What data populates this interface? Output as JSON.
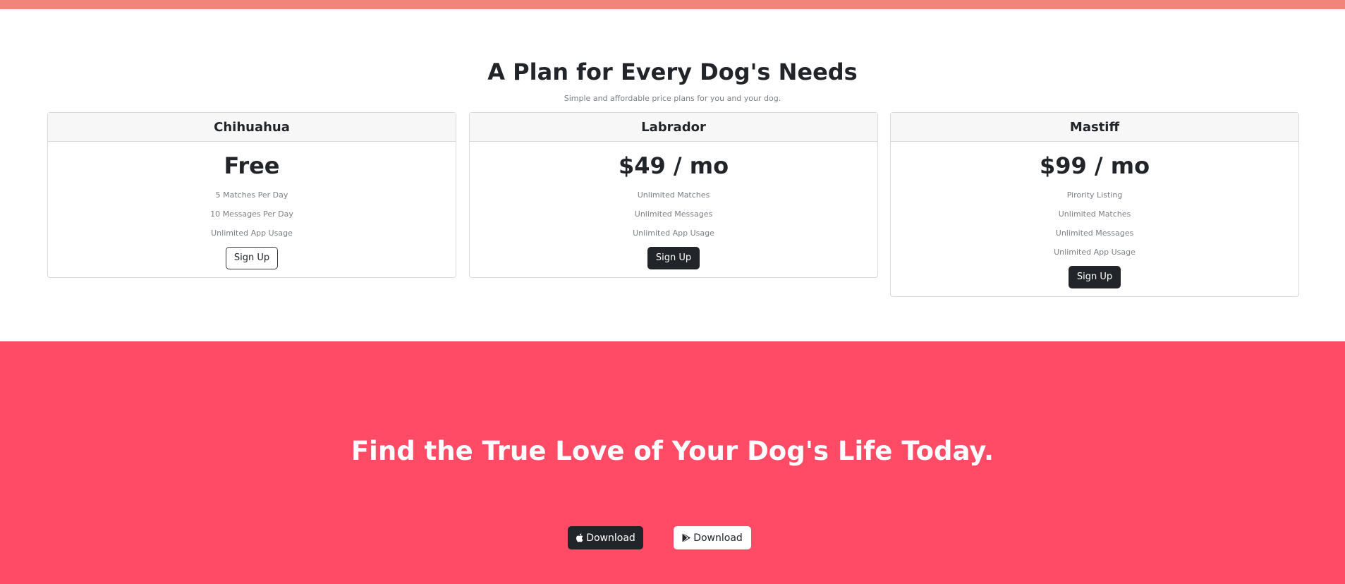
{
  "colors": {
    "top_strip": "#f2857a",
    "cta_background": "#ff4b66",
    "dark": "#212529",
    "muted_text": "#7b7f84"
  },
  "pricing": {
    "title": "A Plan for Every Dog's Needs",
    "subtitle": "Simple and affordable price plans for you and your dog.",
    "plans": [
      {
        "name": "Chihuahua",
        "price": "Free",
        "features": [
          "5 Matches Per Day",
          "10 Messages Per Day",
          "Unlimited App Usage"
        ],
        "button_label": "Sign Up",
        "button_style": "outline"
      },
      {
        "name": "Labrador",
        "price": "$49 / mo",
        "features": [
          "Unlimited Matches",
          "Unlimited Messages",
          "Unlimited App Usage"
        ],
        "button_label": "Sign Up",
        "button_style": "dark"
      },
      {
        "name": "Mastiff",
        "price": "$99 / mo",
        "features": [
          "Pirority Listing",
          "Unlimited Matches",
          "Unlimited Messages",
          "Unlimited App Usage"
        ],
        "button_label": "Sign Up",
        "button_style": "dark"
      }
    ]
  },
  "cta": {
    "title": "Find the True Love of Your Dog's Life Today.",
    "apple_button": {
      "label": "Download",
      "icon": "apple-icon"
    },
    "play_button": {
      "label": "Download",
      "icon": "google-play-icon"
    }
  }
}
